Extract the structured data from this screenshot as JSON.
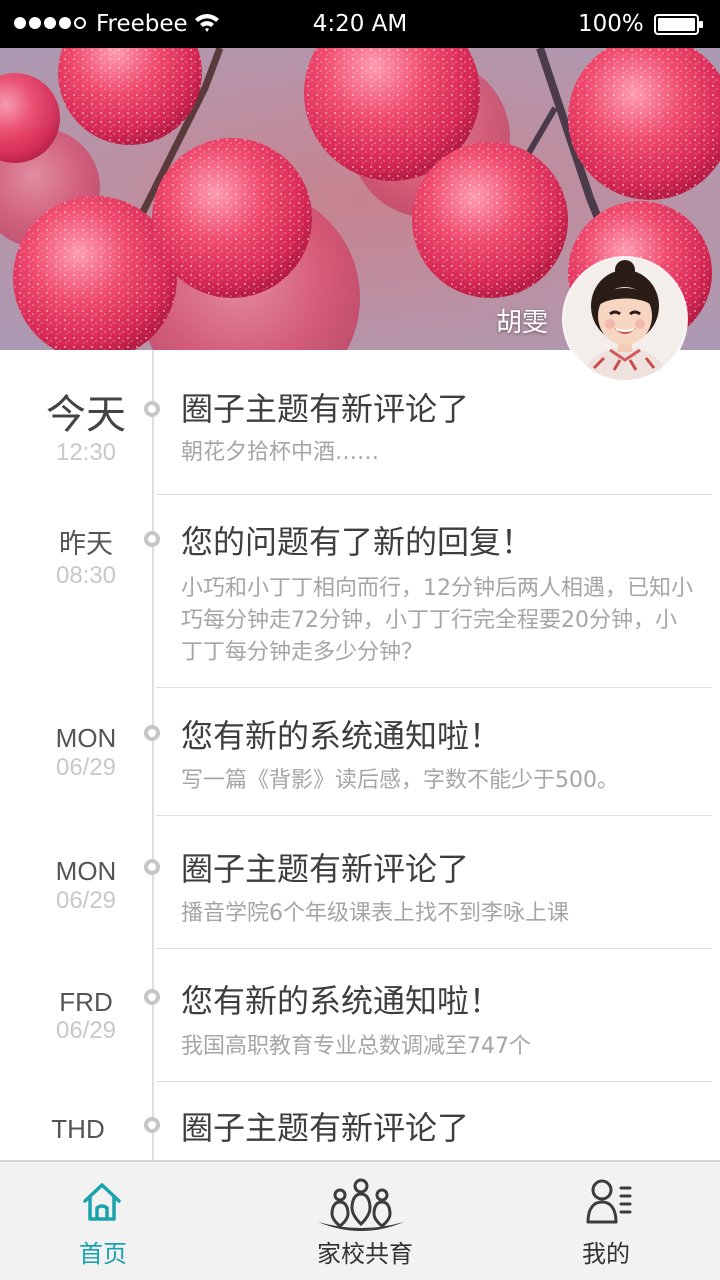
{
  "status_bar": {
    "carrier": "Freebee",
    "time": "4:20 AM",
    "battery": "100%"
  },
  "profile": {
    "name": "胡雯"
  },
  "timeline": [
    {
      "date": "今天",
      "time": "12:30",
      "title": "圈子主题有新评论了",
      "body": "朝花夕拾杯中酒……"
    },
    {
      "date": "昨天",
      "time": "08:30",
      "title": "您的问题有了新的回复！",
      "body": "小巧和小丁丁相向而行，12分钟后两人相遇，已知小巧每分钟走72分钟，小丁丁行完全程要20分钟，小丁丁每分钟走多少分钟？"
    },
    {
      "date": "MON",
      "time": "06/29",
      "title": "您有新的系统通知啦！",
      "body": "写一篇《背影》读后感，字数不能少于500。"
    },
    {
      "date": "MON",
      "time": "06/29",
      "title": "圈子主题有新评论了",
      "body": "播音学院6个年级课表上找不到李咏上课"
    },
    {
      "date": "FRD",
      "time": "06/29",
      "title": "您有新的系统通知啦！",
      "body": "我国高职教育专业总数调减至747个"
    },
    {
      "date": "THD",
      "time": "",
      "title": "圈子主题有新评论了",
      "body": ""
    }
  ],
  "tabs": [
    {
      "label": "首页",
      "icon": "home-icon",
      "active": true
    },
    {
      "label": "家校共育",
      "icon": "family-icon",
      "active": false
    },
    {
      "label": "我的",
      "icon": "profile-list-icon",
      "active": false
    }
  ],
  "colors": {
    "accent": "#1ba3ad",
    "title_text": "#3e3e3e",
    "body_text": "#a6a6a6",
    "time_text": "#c8c8c8",
    "tab_bar_bg": "#f2f2f2"
  }
}
